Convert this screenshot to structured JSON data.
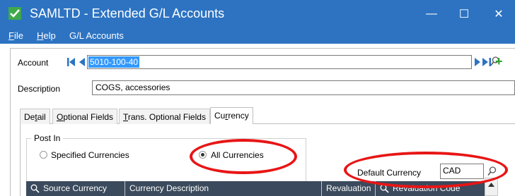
{
  "window": {
    "title": "SAMLTD - Extended G/L Accounts",
    "controls": {
      "minimize": "—",
      "maximize": "☐",
      "close": "✕"
    }
  },
  "menu": {
    "file": {
      "key": "F",
      "rest": "ile"
    },
    "help": {
      "key": "H",
      "rest": "elp"
    },
    "gl_accounts": "G/L Accounts"
  },
  "form": {
    "account_label": "Account",
    "account_value": "5010-100-40",
    "description_label": "Description",
    "description_value": "COGS, accessories"
  },
  "tabs": {
    "detail": {
      "pre": "De",
      "key": "t",
      "post": "ail"
    },
    "optional_fields": {
      "pre": "",
      "key": "O",
      "post": "ptional Fields"
    },
    "trans_optional_fields": {
      "pre": "",
      "key": "T",
      "post": "rans. Optional Fields"
    },
    "currency": {
      "pre": "Cu",
      "key": "r",
      "post": "rency"
    },
    "active": "currency"
  },
  "currency_tab": {
    "post_in_legend": "Post In",
    "specified_currencies": "Specified Currencies",
    "all_currencies": "All Currencies",
    "post_in_selected": "all_currencies",
    "default_currency_label": "Default Currency",
    "default_currency_value": "CAD"
  },
  "grid": {
    "columns": [
      "Source Currency",
      "Currency Description",
      "Revaluation",
      "Revaluation Code"
    ]
  },
  "colors": {
    "titlebar": "#2d73c2",
    "selection": "#3399ff",
    "grid_header": "#3b4a5c",
    "annotation": "#e81515",
    "add_icon": "#2aa52a"
  },
  "icons": [
    "app-icon",
    "first-record-icon",
    "previous-record-icon",
    "next-record-icon",
    "last-record-icon",
    "finder-icon",
    "add-icon",
    "zoom-icon"
  ]
}
